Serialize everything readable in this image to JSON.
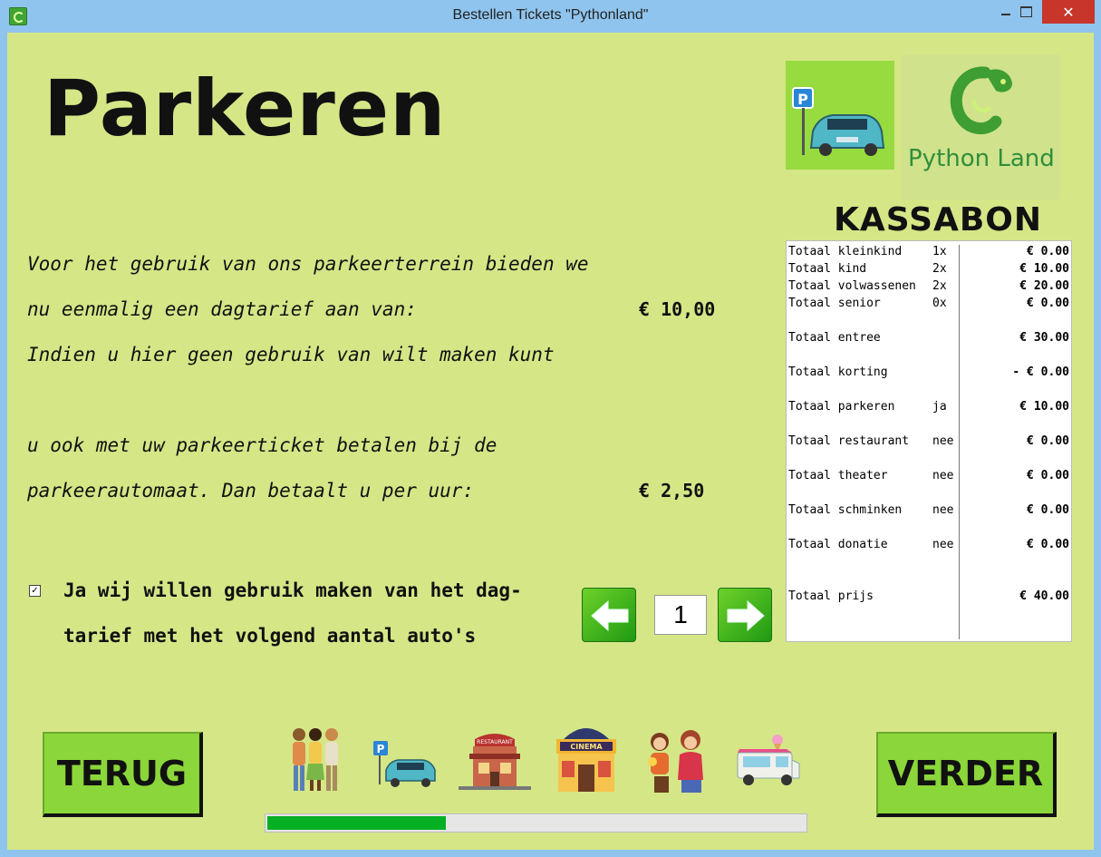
{
  "window": {
    "title": "Bestellen Tickets \"Pythonland\"",
    "close_label": "✕"
  },
  "page": {
    "heading": "Parkeren",
    "logo_text": "Python Land",
    "paragraph_lines": [
      "Voor het gebruik van ons parkeerterrein bieden we",
      "nu eenmalig een dagtarief aan van:",
      "Indien u hier geen gebruik van wilt maken kunt",
      "u ook met uw parkeerticket betalen bij de",
      "parkeerautomaat. Dan betaalt u per uur:"
    ],
    "day_rate": "€ 10,00",
    "hourly_rate": "€ 2,50",
    "checkbox": {
      "checked": true,
      "mark": "✓",
      "label_line1": "Ja wij willen gebruik maken van het dag-",
      "label_line2": "tarief met het volgend aantal auto's"
    },
    "car_count": "1"
  },
  "receipt": {
    "title": "KASSABON",
    "rows": [
      {
        "label": "Totaal kleinkind",
        "qty": "1x",
        "amount": "€ 0.00"
      },
      {
        "label": "Totaal kind",
        "qty": "2x",
        "amount": "€ 10.00"
      },
      {
        "label": "Totaal volwassenen",
        "qty": "2x",
        "amount": "€ 20.00"
      },
      {
        "label": "Totaal senior",
        "qty": "0x",
        "amount": "€ 0.00"
      },
      {
        "label": "Totaal entree",
        "qty": "",
        "amount": "€ 30.00"
      },
      {
        "label": "Totaal korting",
        "qty": "",
        "amount": "- € 0.00"
      },
      {
        "label": "Totaal parkeren",
        "qty": "ja",
        "amount": "€ 10.00"
      },
      {
        "label": "Totaal restaurant",
        "qty": "nee",
        "amount": "€ 0.00"
      },
      {
        "label": "Totaal theater",
        "qty": "nee",
        "amount": "€ 0.00"
      },
      {
        "label": "Totaal schminken",
        "qty": "nee",
        "amount": "€ 0.00"
      },
      {
        "label": "Totaal donatie",
        "qty": "nee",
        "amount": "€ 0.00"
      },
      {
        "label": "Totaal prijs",
        "qty": "",
        "amount": "€ 40.00"
      }
    ]
  },
  "nav": {
    "back_label": "TERUG",
    "next_label": "VERDER",
    "steps": [
      "people-icon",
      "parking-icon",
      "restaurant-icon",
      "cinema-icon",
      "face-paint-icon",
      "ice-cream-truck-icon"
    ],
    "progress_percent": 33
  },
  "colors": {
    "background": "#d5e687",
    "button": "#8bd63a",
    "progress": "#06b025",
    "arrow": "#3fbf1f"
  }
}
